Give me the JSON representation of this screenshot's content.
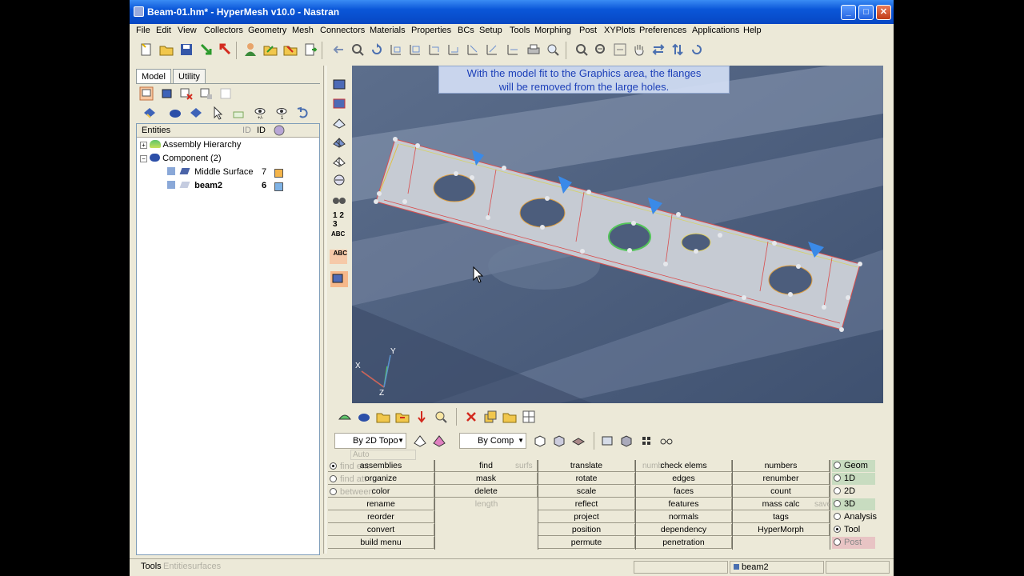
{
  "window": {
    "title": "Beam-01.hm* - HyperMesh v10.0 - Nastran",
    "min": "_",
    "max": "□",
    "close": "✕"
  },
  "menu": [
    "File",
    "Edit",
    "View",
    "Collectors",
    "Geometry",
    "Mesh",
    "Connectors",
    "Materials",
    "Properties",
    "BCs",
    "Setup",
    "Tools",
    "Morphing",
    "Post",
    "XYPlots",
    "Preferences",
    "Applications",
    "Help"
  ],
  "tabs": {
    "model": "Model",
    "utility": "Utility"
  },
  "tree": {
    "col_entities": "Entities",
    "col_id": "ID",
    "rows": {
      "assembly": "Assembly Hierarchy",
      "component": "Component (2)",
      "middle_surface": "Middle Surface",
      "middle_surface_id": "7",
      "beam2": "beam2",
      "beam2_id": "6"
    },
    "colors": {
      "middle_surface": "#f5b54a",
      "beam2": "#7fb3e6"
    }
  },
  "viewport": {
    "message_line1": "With the model fit to the Graphics area, the flanges",
    "message_line2": "will be removed from the large holes.",
    "axis_x": "X",
    "axis_y": "Y",
    "axis_z": "Z",
    "background": "#4b5e7e"
  },
  "vtools": {
    "numbers": "1 2 3",
    "abc1": "ABC",
    "abc2": "ABC"
  },
  "toolbar3": {
    "by2d": "By 2D Topo",
    "bycomp": "By Comp",
    "auto": "Auto"
  },
  "menupanel": {
    "col1": [
      "assemblies",
      "organize",
      "color",
      "rename",
      "reorder",
      "convert",
      "build menu"
    ],
    "col2": [
      "find",
      "mask",
      "delete",
      "length"
    ],
    "col3": [
      "translate",
      "rotate",
      "scale",
      "reflect",
      "project",
      "position",
      "permute"
    ],
    "col4": [
      "check elems",
      "edges",
      "faces",
      "features",
      "normals",
      "dependency",
      "penetration"
    ],
    "col5": [
      "numbers",
      "renumber",
      "count",
      "mass calc",
      "tags",
      "HyperMorph"
    ],
    "ghosts": {
      "find_ent": "find ent",
      "find_att": "find att",
      "between": "between",
      "surfs": "surfs",
      "numb": "numb",
      "save": "save"
    },
    "radios": [
      "Geom",
      "1D",
      "2D",
      "3D",
      "Analysis",
      "Tool",
      "Post"
    ],
    "selected_radio": "Tool"
  },
  "status": {
    "left": "Tools",
    "ghost": "Entitiesurfaces",
    "component": "beam2"
  }
}
